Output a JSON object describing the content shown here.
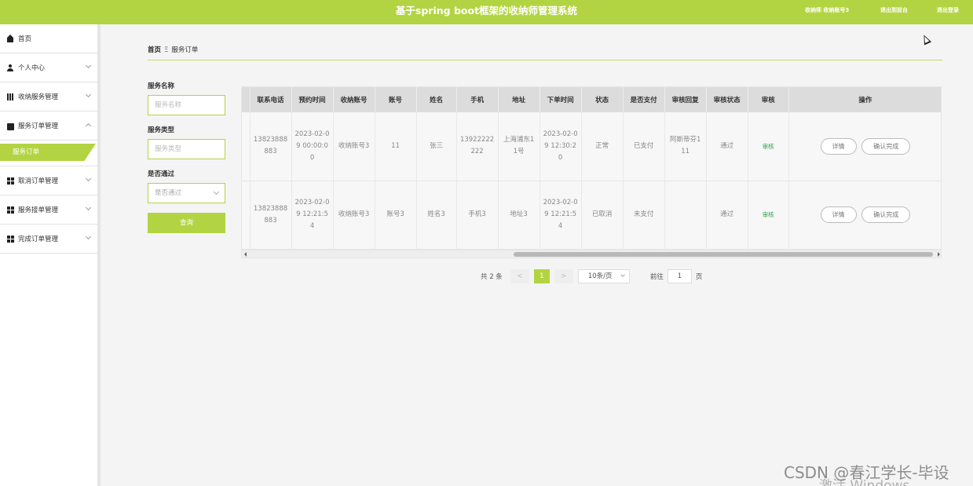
{
  "header": {
    "title": "基于spring boot框架的收纳师管理系统",
    "user_info": "收纳师 收纳账号3",
    "back_home": "退出到前台",
    "logout": "退出登录"
  },
  "sidebar": {
    "items": [
      {
        "label": "首页",
        "icon": "home-icon"
      },
      {
        "label": "个人中心",
        "icon": "user-icon"
      },
      {
        "label": "收纳服务管理",
        "icon": "bar-chart-icon"
      },
      {
        "label": "服务订单管理",
        "icon": "briefcase-icon",
        "expanded": true
      },
      {
        "label": "取消订单管理",
        "icon": "grid-icon"
      },
      {
        "label": "服务接单管理",
        "icon": "grid-icon"
      },
      {
        "label": "完成订单管理",
        "icon": "table-icon"
      }
    ],
    "active_sub": "服务订单"
  },
  "breadcrumb": {
    "home": "首页",
    "sep": "Ξ",
    "current": "服务订单"
  },
  "filters": {
    "service_name_label": "服务名称",
    "service_name_placeholder": "服务名称",
    "service_type_label": "服务类型",
    "service_type_placeholder": "服务类型",
    "approved_label": "是否通过",
    "approved_placeholder": "是否通过",
    "query_button": "查询"
  },
  "table": {
    "columns": [
      "联系电话",
      "预约时间",
      "收纳账号",
      "账号",
      "姓名",
      "手机",
      "地址",
      "下单时间",
      "状态",
      "是否支付",
      "审核回复",
      "审核状态",
      "审核",
      "操作"
    ],
    "rows": [
      {
        "phone": "13823888883",
        "appointment_time": "2023-02-09 00:00:00",
        "organizer_account": "收纳账号3",
        "account": "11",
        "name": "张三",
        "mobile": "13922222222",
        "address": "上海浦东11号",
        "order_time": "2023-02-09 12:30:20",
        "status": "正常",
        "paid": "已支付",
        "review_reply": "阿斯蒂芬111",
        "review_status": "通过",
        "audit": "审核",
        "detail_btn": "详情",
        "confirm_btn": "确认完成"
      },
      {
        "phone": "13823888883",
        "appointment_time": "2023-02-09 12:21:54",
        "organizer_account": "收纳账号3",
        "account": "账号3",
        "name": "姓名3",
        "mobile": "手机3",
        "address": "地址3",
        "order_time": "2023-02-09 12:21:54",
        "status": "已取消",
        "paid": "未支付",
        "review_reply": "",
        "review_status": "通过",
        "audit": "审核",
        "detail_btn": "详情",
        "confirm_btn": "确认完成"
      }
    ]
  },
  "pagination": {
    "total": "共 2 条",
    "prev": "<",
    "current": "1",
    "next": ">",
    "page_size": "10条/页",
    "goto_label": "前往",
    "goto_value": "1",
    "page_unit": "页"
  },
  "overlay": {
    "watermark": "CSDN @春江学长-毕设",
    "activate": "激活 Windows"
  },
  "colors": {
    "accent": "#b3d442",
    "audit_text": "#2ca64a"
  }
}
